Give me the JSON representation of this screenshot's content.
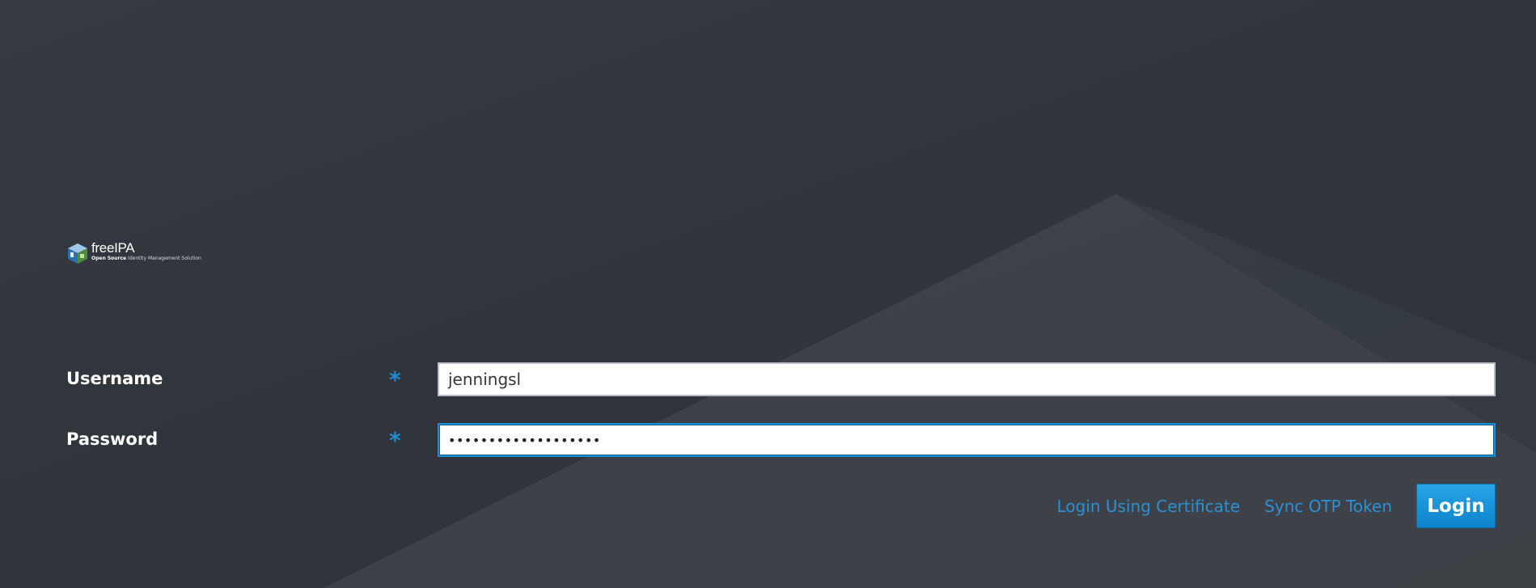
{
  "brand": {
    "name": "freeIPA",
    "tagline_bold": "Open Source",
    "tagline_rest": "Identity Management Solution",
    "logo_icon": "cube-icon"
  },
  "form": {
    "username": {
      "label": "Username",
      "required_marker": "*",
      "value": "jenningsl"
    },
    "password": {
      "label": "Password",
      "required_marker": "*",
      "masked_value": "•••••••••••••••••••"
    }
  },
  "actions": {
    "cert_login_label": "Login Using Certificate",
    "sync_otp_label": "Sync OTP Token",
    "login_label": "Login"
  },
  "colors": {
    "background": "#33383e",
    "accent": "#1e8ad0",
    "link": "#2a91d6",
    "button": "#0e83cd"
  }
}
